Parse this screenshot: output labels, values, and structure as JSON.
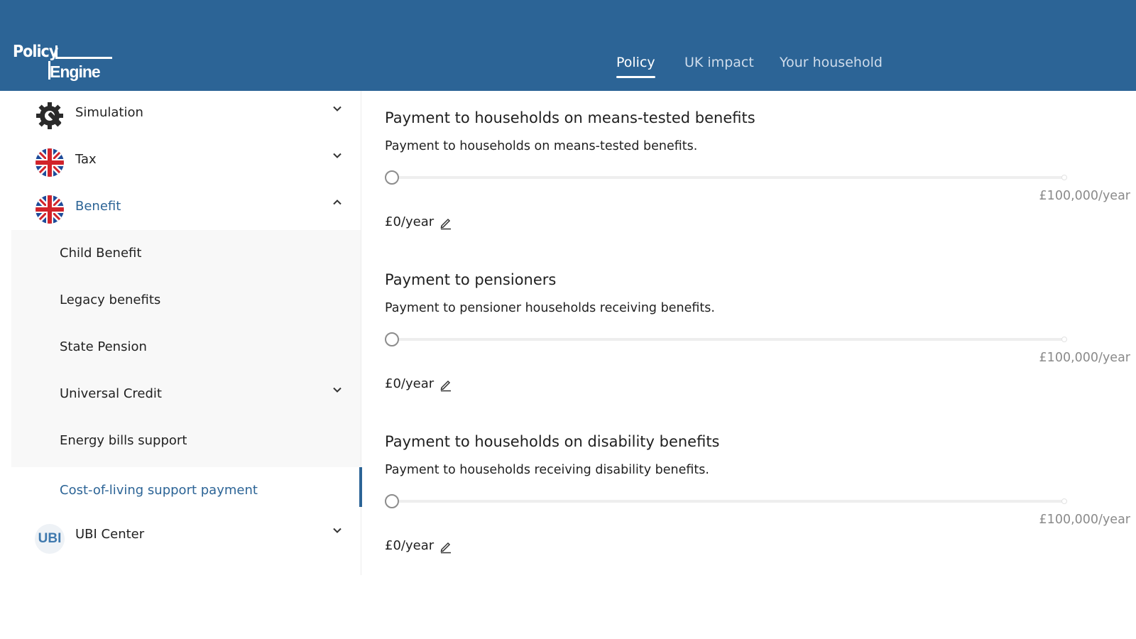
{
  "header": {
    "logo_line1": "Policy",
    "logo_line2": "Engine",
    "tabs": [
      {
        "label": "Policy",
        "active": true
      },
      {
        "label": "UK impact",
        "active": false
      },
      {
        "label": "Your household",
        "active": false
      }
    ],
    "background_color": "#2c6496"
  },
  "sidebar": {
    "items": [
      {
        "label": "Simulation",
        "icon": "gear-wrench-icon",
        "expanded": false
      },
      {
        "label": "Tax",
        "icon": "uk-flag-icon",
        "expanded": false
      },
      {
        "label": "Benefit",
        "icon": "uk-flag-icon",
        "expanded": true
      },
      {
        "label": "UBI Center",
        "icon": "ubi-logo-icon",
        "badge": "UBI",
        "expanded": false
      }
    ],
    "benefit_subitems": [
      {
        "label": "Child Benefit"
      },
      {
        "label": "Legacy benefits"
      },
      {
        "label": "State Pension"
      },
      {
        "label": "Universal Credit",
        "has_children": true
      },
      {
        "label": "Energy bills support"
      },
      {
        "label": "Cost-of-living support payment",
        "selected": true
      }
    ],
    "accent_color": "#2c6496"
  },
  "main": {
    "parameters": [
      {
        "title": "Payment to households on means-tested benefits",
        "description": "Payment to households on means-tested benefits.",
        "value": "£0/year",
        "max_label": "£100,000/year",
        "slider_fraction": 0
      },
      {
        "title": "Payment to pensioners",
        "description": "Payment to pensioner households receiving benefits.",
        "value": "£0/year",
        "max_label": "£100,000/year",
        "slider_fraction": 0
      },
      {
        "title": "Payment to households on disability benefits",
        "description": "Payment to households receiving disability benefits.",
        "value": "£0/year",
        "max_label": "£100,000/year",
        "slider_fraction": 0
      }
    ]
  }
}
